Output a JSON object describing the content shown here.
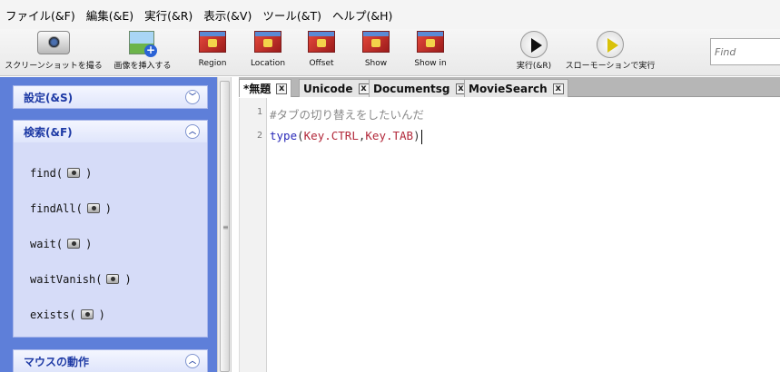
{
  "menu": [
    {
      "label": "ファイル(&F)"
    },
    {
      "label": "編集(&E)"
    },
    {
      "label": "実行(&R)"
    },
    {
      "label": "表示(&V)"
    },
    {
      "label": "ツール(&T)"
    },
    {
      "label": "ヘルプ(&H)"
    }
  ],
  "toolbar": {
    "screenshot_label": "スクリーンショットを撮る",
    "insert_image_label": "画像を挿入する",
    "region_label": "Region",
    "location_label": "Location",
    "offset_label": "Offset",
    "show_label": "Show",
    "showin_label": "Show in",
    "run_label": "実行(&R)",
    "slowmo_label": "スローモーションで実行",
    "find_placeholder": "Find"
  },
  "sidebar": {
    "settings_title": "設定(&S)",
    "search_title": "検索(&F)",
    "mouse_title": "マウスの動作",
    "commands": [
      {
        "name": "find("
      },
      {
        "name": "findAll("
      },
      {
        "name": "wait("
      },
      {
        "name": "waitVanish("
      },
      {
        "name": "exists("
      }
    ],
    "close_paren": ")"
  },
  "tabs": [
    {
      "label": "*無題"
    },
    {
      "label": "Unicode"
    },
    {
      "label": "Documentsg"
    },
    {
      "label": "MovieSearch"
    }
  ],
  "tab_close": "x",
  "editor": {
    "line_numbers": [
      "1",
      "2"
    ],
    "line1_comment": "#タブの切り替えをしたいんだ",
    "line2": {
      "fn": "type",
      "open": "(",
      "arg1": "Key.CTRL",
      "comma": ",",
      "arg2": "Key.TAB",
      "close": ")"
    }
  },
  "icons": {
    "camera": "camera-icon",
    "insert_image": "insert-image-icon",
    "screen": "screen-region-icon",
    "run": "play-icon",
    "slowmo": "slow-play-icon",
    "collapse": "chevron-up-icon",
    "expand": "chevron-down-icon"
  }
}
